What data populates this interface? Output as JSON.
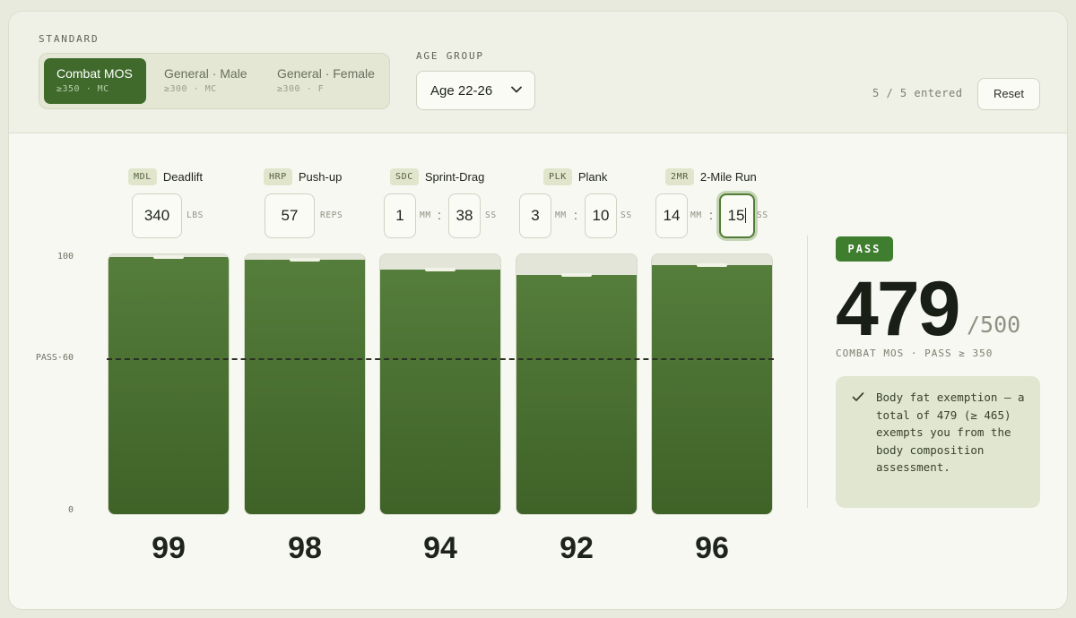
{
  "standard": {
    "label": "STANDARD",
    "options": [
      {
        "title": "Combat MOS",
        "sub": "≥350 · MC"
      },
      {
        "title": "General · Male",
        "sub": "≥300 · MC"
      },
      {
        "title": "General · Female",
        "sub": "≥300 · F"
      }
    ],
    "selected": "Combat MOS"
  },
  "age_group": {
    "label": "AGE GROUP",
    "value": "Age 22-26"
  },
  "entered": "5 / 5 entered",
  "reset_label": "Reset",
  "events": [
    {
      "code": "MDL",
      "name": "Deadlift",
      "inputs": [
        {
          "value": "340",
          "unit": "LBS"
        }
      ]
    },
    {
      "code": "HRP",
      "name": "Push-up",
      "inputs": [
        {
          "value": "57",
          "unit": "REPS"
        }
      ]
    },
    {
      "code": "SDC",
      "name": "Sprint-Drag",
      "inputs": [
        {
          "value": "1",
          "unit": "MM"
        },
        {
          "value": "38",
          "unit": "SS"
        }
      ]
    },
    {
      "code": "PLK",
      "name": "Plank",
      "inputs": [
        {
          "value": "3",
          "unit": "MM"
        },
        {
          "value": "10",
          "unit": "SS"
        }
      ]
    },
    {
      "code": "2MR",
      "name": "2-Mile Run",
      "inputs": [
        {
          "value": "14",
          "unit": "MM"
        },
        {
          "value": "15",
          "unit": "SS"
        }
      ]
    }
  ],
  "time_separator": ":",
  "chart_data": {
    "type": "bar",
    "categories": [
      "Deadlift",
      "Push-up",
      "Sprint-Drag",
      "Plank",
      "2-Mile Run"
    ],
    "values": [
      99,
      98,
      94,
      92,
      96
    ],
    "ylim": [
      0,
      100
    ],
    "y_tick_labels": [
      "100",
      "0"
    ],
    "threshold": {
      "label": "PASS·60",
      "value": 60
    }
  },
  "result": {
    "badge": "PASS",
    "total": "479",
    "max": "/500",
    "summary": "COMBAT MOS · PASS ≥ 350",
    "note": "Body fat exemption — a total of 479 (≥ 465) exempts you from the body composition assessment."
  },
  "colors": {
    "accent": "#3f6a2b",
    "bar": "#4a7132",
    "pass_badge": "#3f7d2f",
    "note_bg": "#e0e6cf"
  }
}
